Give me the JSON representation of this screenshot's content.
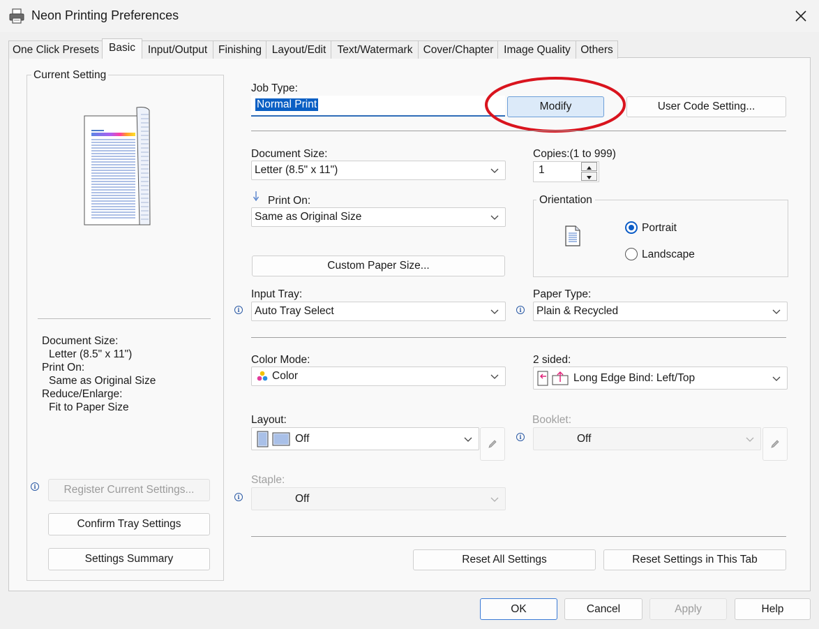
{
  "window": {
    "title": "Neon Printing Preferences"
  },
  "tabs": [
    {
      "label": "One Click Presets",
      "active": false
    },
    {
      "label": "Basic",
      "active": true
    },
    {
      "label": "Input/Output",
      "active": false
    },
    {
      "label": "Finishing",
      "active": false
    },
    {
      "label": "Layout/Edit",
      "active": false
    },
    {
      "label": "Text/Watermark",
      "active": false
    },
    {
      "label": "Cover/Chapter",
      "active": false
    },
    {
      "label": "Image Quality",
      "active": false
    },
    {
      "label": "Others",
      "active": false
    }
  ],
  "current_setting": {
    "legend": "Current Setting",
    "summary": [
      "Document Size:",
      "Letter (8.5\" x 11\")",
      "Print On:",
      "Same as Original Size",
      "Reduce/Enlarge:",
      "Fit to Paper Size"
    ],
    "register_button": "Register Current Settings...",
    "confirm_tray_button": "Confirm Tray Settings",
    "settings_summary_button": "Settings Summary"
  },
  "job_type": {
    "label": "Job Type:",
    "value": "Normal Print",
    "modify_button": "Modify",
    "user_code_button": "User Code Setting..."
  },
  "document_size": {
    "label": "Document Size:",
    "value": "Letter (8.5\" x 11\")"
  },
  "copies": {
    "label": "Copies:(1 to 999)",
    "value": "1"
  },
  "print_on": {
    "label": "Print On:",
    "value": "Same as Original Size"
  },
  "orientation": {
    "legend": "Orientation",
    "portrait": "Portrait",
    "landscape": "Landscape",
    "selected": "Portrait"
  },
  "custom_paper_button": "Custom Paper Size...",
  "input_tray": {
    "label": "Input Tray:",
    "value": "Auto Tray Select"
  },
  "paper_type": {
    "label": "Paper Type:",
    "value": "Plain & Recycled"
  },
  "color_mode": {
    "label": "Color Mode:",
    "value": "Color"
  },
  "two_sided": {
    "label": "2 sided:",
    "value": "Long Edge Bind: Left/Top"
  },
  "layout": {
    "label": "Layout:",
    "value": "Off"
  },
  "booklet": {
    "label": "Booklet:",
    "value": "Off"
  },
  "staple": {
    "label": "Staple:",
    "value": "Off"
  },
  "reset_all_button": "Reset All Settings",
  "reset_tab_button": "Reset Settings in This Tab",
  "footer": {
    "ok": "OK",
    "cancel": "Cancel",
    "apply": "Apply",
    "help": "Help"
  },
  "colors": {
    "accent": "#0a5fc4",
    "highlight_circle": "#d9141e"
  },
  "icons": [
    "printer-icon",
    "close-icon",
    "info-icon",
    "chevron-down-icon",
    "pencil-icon",
    "portrait-page-icon",
    "color-dots-icon",
    "duplex-icon",
    "layout-page-icon",
    "down-arrow-icon"
  ]
}
